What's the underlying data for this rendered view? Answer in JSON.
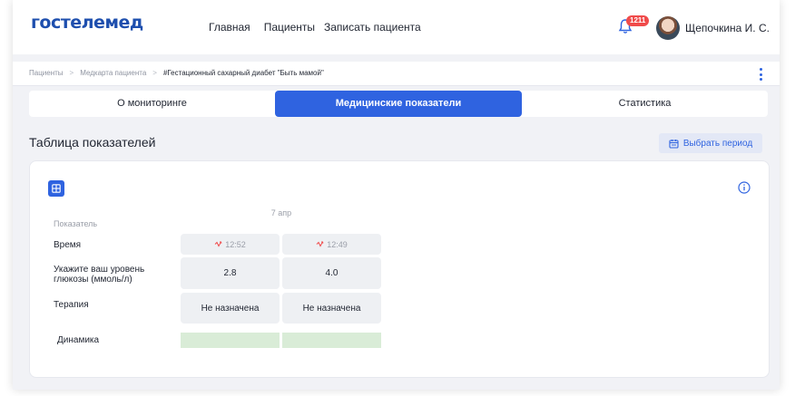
{
  "header": {
    "logo": "гостелемед",
    "nav": [
      "Главная",
      "Пациенты",
      "Записать пациента"
    ],
    "notifications_count": "1211",
    "user_name": "Щепочкина И. С."
  },
  "breadcrumb": {
    "items": [
      "Пациенты",
      "Медкарта пациента"
    ],
    "current": "#Гестационный сахарный диабет \"Быть мамой\""
  },
  "tabs": [
    {
      "label": "О мониторинге",
      "active": false
    },
    {
      "label": "Медицинские показатели",
      "active": true
    },
    {
      "label": "Статистика",
      "active": false
    }
  ],
  "section": {
    "title": "Таблица показателей",
    "period_button": "Выбрать период"
  },
  "table": {
    "date": "7 апр",
    "header_label": "Показатель",
    "rows": {
      "time": {
        "label": "Время",
        "values": [
          "12:52",
          "12:49"
        ]
      },
      "glucose": {
        "label": "Укажите ваш уровень глюкозы (ммоль/л)",
        "values": [
          "2.8",
          "4.0"
        ]
      },
      "therapy": {
        "label": "Терапия",
        "values": [
          "Не назначена",
          "Не назначена"
        ]
      },
      "dynamics": {
        "label": "Динамика"
      }
    }
  },
  "colors": {
    "accent": "#2f63e0",
    "logo": "#1e4fae",
    "badge": "#f04b4b",
    "dynamics_fill": "#d9ecd7",
    "time_icon": "#f04b4b"
  },
  "icons": [
    "bell-icon",
    "avatar",
    "kebab-menu-icon",
    "grid-icon",
    "info-icon",
    "calendar-icon",
    "lightning-icon"
  ]
}
